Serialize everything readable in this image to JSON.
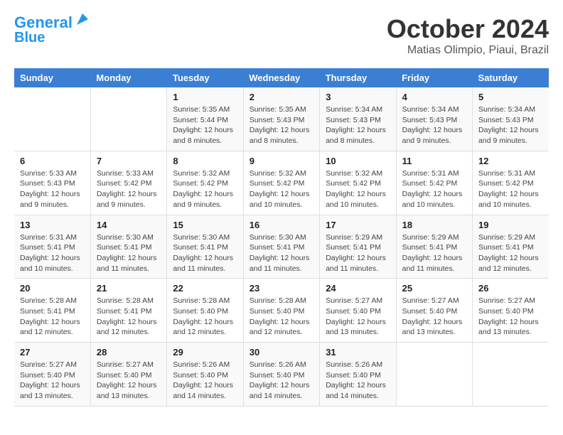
{
  "logo": {
    "line1": "General",
    "line2": "Blue"
  },
  "title": "October 2024",
  "subtitle": "Matias Olimpio, Piaui, Brazil",
  "days_of_week": [
    "Sunday",
    "Monday",
    "Tuesday",
    "Wednesday",
    "Thursday",
    "Friday",
    "Saturday"
  ],
  "weeks": [
    [
      {
        "day": "",
        "info": ""
      },
      {
        "day": "",
        "info": ""
      },
      {
        "day": "1",
        "sunrise": "Sunrise: 5:35 AM",
        "sunset": "Sunset: 5:44 PM",
        "daylight": "Daylight: 12 hours and 8 minutes."
      },
      {
        "day": "2",
        "sunrise": "Sunrise: 5:35 AM",
        "sunset": "Sunset: 5:43 PM",
        "daylight": "Daylight: 12 hours and 8 minutes."
      },
      {
        "day": "3",
        "sunrise": "Sunrise: 5:34 AM",
        "sunset": "Sunset: 5:43 PM",
        "daylight": "Daylight: 12 hours and 8 minutes."
      },
      {
        "day": "4",
        "sunrise": "Sunrise: 5:34 AM",
        "sunset": "Sunset: 5:43 PM",
        "daylight": "Daylight: 12 hours and 9 minutes."
      },
      {
        "day": "5",
        "sunrise": "Sunrise: 5:34 AM",
        "sunset": "Sunset: 5:43 PM",
        "daylight": "Daylight: 12 hours and 9 minutes."
      }
    ],
    [
      {
        "day": "6",
        "sunrise": "Sunrise: 5:33 AM",
        "sunset": "Sunset: 5:43 PM",
        "daylight": "Daylight: 12 hours and 9 minutes."
      },
      {
        "day": "7",
        "sunrise": "Sunrise: 5:33 AM",
        "sunset": "Sunset: 5:42 PM",
        "daylight": "Daylight: 12 hours and 9 minutes."
      },
      {
        "day": "8",
        "sunrise": "Sunrise: 5:32 AM",
        "sunset": "Sunset: 5:42 PM",
        "daylight": "Daylight: 12 hours and 9 minutes."
      },
      {
        "day": "9",
        "sunrise": "Sunrise: 5:32 AM",
        "sunset": "Sunset: 5:42 PM",
        "daylight": "Daylight: 12 hours and 10 minutes."
      },
      {
        "day": "10",
        "sunrise": "Sunrise: 5:32 AM",
        "sunset": "Sunset: 5:42 PM",
        "daylight": "Daylight: 12 hours and 10 minutes."
      },
      {
        "day": "11",
        "sunrise": "Sunrise: 5:31 AM",
        "sunset": "Sunset: 5:42 PM",
        "daylight": "Daylight: 12 hours and 10 minutes."
      },
      {
        "day": "12",
        "sunrise": "Sunrise: 5:31 AM",
        "sunset": "Sunset: 5:42 PM",
        "daylight": "Daylight: 12 hours and 10 minutes."
      }
    ],
    [
      {
        "day": "13",
        "sunrise": "Sunrise: 5:31 AM",
        "sunset": "Sunset: 5:41 PM",
        "daylight": "Daylight: 12 hours and 10 minutes."
      },
      {
        "day": "14",
        "sunrise": "Sunrise: 5:30 AM",
        "sunset": "Sunset: 5:41 PM",
        "daylight": "Daylight: 12 hours and 11 minutes."
      },
      {
        "day": "15",
        "sunrise": "Sunrise: 5:30 AM",
        "sunset": "Sunset: 5:41 PM",
        "daylight": "Daylight: 12 hours and 11 minutes."
      },
      {
        "day": "16",
        "sunrise": "Sunrise: 5:30 AM",
        "sunset": "Sunset: 5:41 PM",
        "daylight": "Daylight: 12 hours and 11 minutes."
      },
      {
        "day": "17",
        "sunrise": "Sunrise: 5:29 AM",
        "sunset": "Sunset: 5:41 PM",
        "daylight": "Daylight: 12 hours and 11 minutes."
      },
      {
        "day": "18",
        "sunrise": "Sunrise: 5:29 AM",
        "sunset": "Sunset: 5:41 PM",
        "daylight": "Daylight: 12 hours and 11 minutes."
      },
      {
        "day": "19",
        "sunrise": "Sunrise: 5:29 AM",
        "sunset": "Sunset: 5:41 PM",
        "daylight": "Daylight: 12 hours and 12 minutes."
      }
    ],
    [
      {
        "day": "20",
        "sunrise": "Sunrise: 5:28 AM",
        "sunset": "Sunset: 5:41 PM",
        "daylight": "Daylight: 12 hours and 12 minutes."
      },
      {
        "day": "21",
        "sunrise": "Sunrise: 5:28 AM",
        "sunset": "Sunset: 5:41 PM",
        "daylight": "Daylight: 12 hours and 12 minutes."
      },
      {
        "day": "22",
        "sunrise": "Sunrise: 5:28 AM",
        "sunset": "Sunset: 5:40 PM",
        "daylight": "Daylight: 12 hours and 12 minutes."
      },
      {
        "day": "23",
        "sunrise": "Sunrise: 5:28 AM",
        "sunset": "Sunset: 5:40 PM",
        "daylight": "Daylight: 12 hours and 12 minutes."
      },
      {
        "day": "24",
        "sunrise": "Sunrise: 5:27 AM",
        "sunset": "Sunset: 5:40 PM",
        "daylight": "Daylight: 12 hours and 13 minutes."
      },
      {
        "day": "25",
        "sunrise": "Sunrise: 5:27 AM",
        "sunset": "Sunset: 5:40 PM",
        "daylight": "Daylight: 12 hours and 13 minutes."
      },
      {
        "day": "26",
        "sunrise": "Sunrise: 5:27 AM",
        "sunset": "Sunset: 5:40 PM",
        "daylight": "Daylight: 12 hours and 13 minutes."
      }
    ],
    [
      {
        "day": "27",
        "sunrise": "Sunrise: 5:27 AM",
        "sunset": "Sunset: 5:40 PM",
        "daylight": "Daylight: 12 hours and 13 minutes."
      },
      {
        "day": "28",
        "sunrise": "Sunrise: 5:27 AM",
        "sunset": "Sunset: 5:40 PM",
        "daylight": "Daylight: 12 hours and 13 minutes."
      },
      {
        "day": "29",
        "sunrise": "Sunrise: 5:26 AM",
        "sunset": "Sunset: 5:40 PM",
        "daylight": "Daylight: 12 hours and 14 minutes."
      },
      {
        "day": "30",
        "sunrise": "Sunrise: 5:26 AM",
        "sunset": "Sunset: 5:40 PM",
        "daylight": "Daylight: 12 hours and 14 minutes."
      },
      {
        "day": "31",
        "sunrise": "Sunrise: 5:26 AM",
        "sunset": "Sunset: 5:40 PM",
        "daylight": "Daylight: 12 hours and 14 minutes."
      },
      {
        "day": "",
        "info": ""
      },
      {
        "day": "",
        "info": ""
      }
    ]
  ]
}
